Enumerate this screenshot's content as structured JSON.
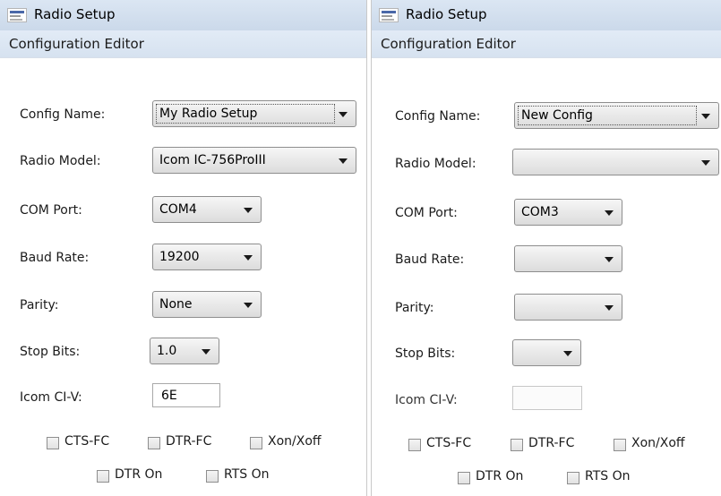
{
  "left": {
    "window_title": "Radio Setup",
    "section": "Configuration Editor",
    "fields": {
      "config_name": {
        "label": "Config Name:",
        "value": "My Radio Setup"
      },
      "radio_model": {
        "label": "Radio Model:",
        "value": "Icom IC-756ProIII"
      },
      "com_port": {
        "label": "COM Port:",
        "value": "COM4"
      },
      "baud_rate": {
        "label": "Baud Rate:",
        "value": "19200"
      },
      "parity": {
        "label": "Parity:",
        "value": "None"
      },
      "stop_bits": {
        "label": "Stop Bits:",
        "value": "1.0"
      },
      "icom_civ": {
        "label": "Icom CI-V:",
        "value": "6E"
      }
    },
    "checkboxes": {
      "cts_fc": "CTS-FC",
      "dtr_fc": "DTR-FC",
      "xon_xoff": "Xon/Xoff",
      "dtr_on": "DTR On",
      "rts_on": "RTS On"
    }
  },
  "right": {
    "window_title": "Radio Setup",
    "section": "Configuration Editor",
    "fields": {
      "config_name": {
        "label": "Config Name:",
        "value": "New Config"
      },
      "radio_model": {
        "label": "Radio Model:",
        "value": ""
      },
      "com_port": {
        "label": "COM Port:",
        "value": "COM3"
      },
      "baud_rate": {
        "label": "Baud Rate:",
        "value": ""
      },
      "parity": {
        "label": "Parity:",
        "value": ""
      },
      "stop_bits": {
        "label": "Stop Bits:",
        "value": ""
      },
      "icom_civ": {
        "label": "Icom CI-V:",
        "value": ""
      }
    },
    "checkboxes": {
      "cts_fc": "CTS-FC",
      "dtr_fc": "DTR-FC",
      "xon_xoff": "Xon/Xoff",
      "dtr_on": "DTR On",
      "rts_on": "RTS On"
    }
  },
  "icons": {
    "app": "app-logo-icon",
    "dropdown": "chevron-down-icon"
  }
}
